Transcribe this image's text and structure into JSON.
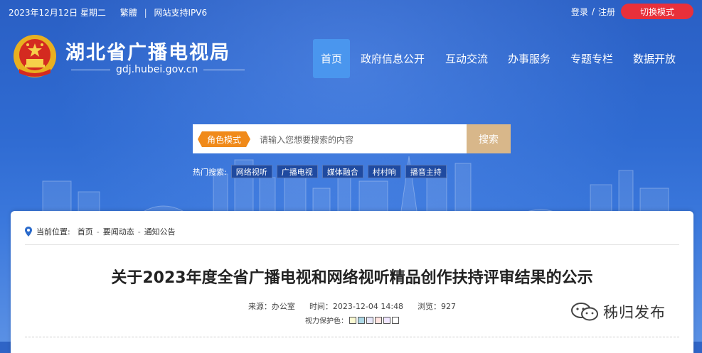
{
  "topbar": {
    "date": "2023年12月12日 星期二",
    "traditional": "繁體",
    "separator": "|",
    "ipv6": "网站支持IPV6",
    "login": "登录",
    "slash": "/",
    "register": "注册",
    "mode_switch": "切换模式"
  },
  "site": {
    "title": "湖北省广播电视局",
    "domain": "gdj.hubei.gov.cn"
  },
  "nav": {
    "items": [
      "首页",
      "政府信息公开",
      "互动交流",
      "办事服务",
      "专题专栏",
      "数据开放"
    ],
    "active": "首页"
  },
  "search": {
    "role_tag": "角色模式",
    "placeholder": "请输入您想要搜索的内容",
    "button": "搜索"
  },
  "hot": {
    "label": "热门搜索:",
    "tags": [
      "网络视听",
      "广播电视",
      "媒体融合",
      "村村响",
      "播音主持"
    ]
  },
  "breadcrumb": {
    "label": "当前位置:",
    "items": [
      "首页",
      "要闻动态",
      "通知公告"
    ],
    "separator": "-"
  },
  "article": {
    "title": "关于2023年度全省广播电视和网络视听精品创作扶持评审结果的公示",
    "source": "来源：办公室",
    "time": "时间：2023-12-04 14:48",
    "views": "浏览：927",
    "eye_care_label": "视力保护色："
  },
  "eye_colors": [
    "#fafad2",
    "#add8e6",
    "#e6e6fa",
    "#ffe4e1",
    "#f0e6ff",
    "#ffffff"
  ],
  "watermark": {
    "text": "秭归发布"
  },
  "colors": {
    "banner": "#2f64c6",
    "mode_button": "#e8303a",
    "nav_active": "#4a96ee",
    "role_tag": "#f08a1a",
    "search_button": "#d8b78a"
  }
}
